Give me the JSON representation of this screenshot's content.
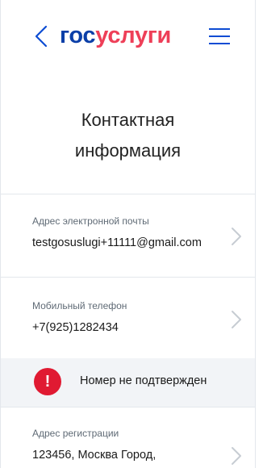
{
  "header": {
    "logo_part1": "гос",
    "logo_part2": "услуги",
    "colors": {
      "accent": "#0d4cd3",
      "logo_blue": "#0b3fa8",
      "logo_red": "#ee3f58"
    }
  },
  "page": {
    "title_line1": "Контактная",
    "title_line2": "информация"
  },
  "rows": [
    {
      "label": "Адрес электронной почты",
      "value": "testgosuslugi+11111@gmail.com"
    },
    {
      "label": "Мобильный телефон",
      "value": "+7(925)1282434"
    },
    {
      "label": "Адрес регистрации",
      "value": "123456, Москва Город,"
    }
  ],
  "warning": {
    "icon_glyph": "!",
    "text": "Номер не подтвержден",
    "color": "#e01a32"
  }
}
